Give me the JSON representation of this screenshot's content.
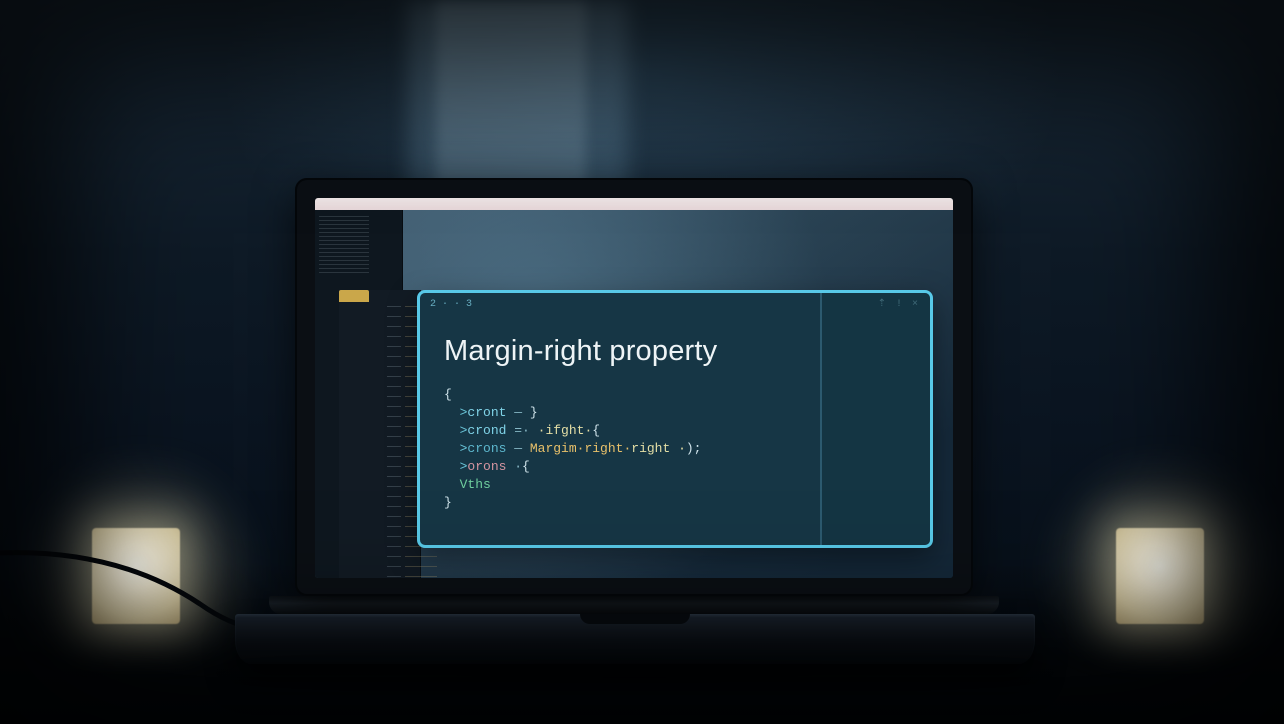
{
  "popup": {
    "breadcrumb": "2 · · 3",
    "title": "Margin-right property",
    "code": {
      "l1": "{",
      "l2_sym": ">",
      "l2_id": "cront",
      "l2_op": " — ",
      "l2_end": "}",
      "l3_sym": ">",
      "l3_id": "crond",
      "l3_op": " =· ",
      "l3_kw": "·ifght·",
      "l3_end": "{",
      "l4_sym": ">",
      "l4_id": "crons",
      "l4_op": " — ",
      "l4_hl": "Margim·right·",
      "l4_kw": "right ·",
      "l4_end": ");",
      "l5_sym": ">",
      "l5_id": "orons",
      "l5_op": " ·",
      "l5_end": "{",
      "l6_kw": "Vths",
      "l7": "}"
    }
  },
  "header_icons": {
    "pin": "⇡",
    "bang": "!",
    "close": "×"
  }
}
